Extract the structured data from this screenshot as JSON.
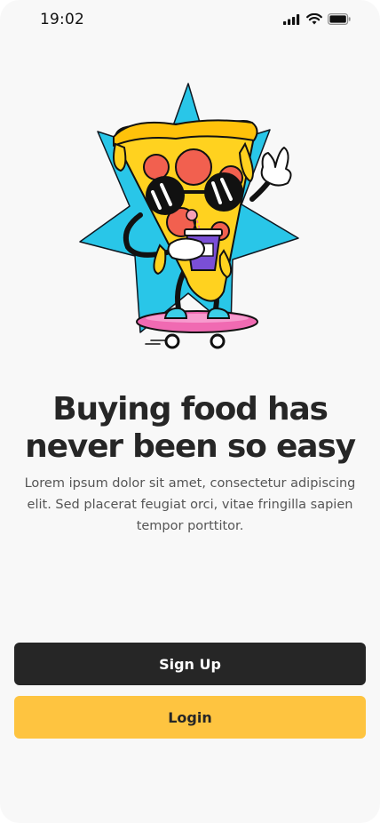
{
  "status_bar": {
    "time": "19:02"
  },
  "onboarding": {
    "headline_line1": "Buying food has",
    "headline_line2": "never been so easy",
    "description": "Lorem ipsum dolor sit amet, consectetur adipiscing elit. Sed placerat feugiat orci, vitae fringilla sapien tempor porttitor.",
    "illustration": "pizza-slice-skateboard-character"
  },
  "actions": {
    "signup_label": "Sign Up",
    "login_label": "Login"
  },
  "colors": {
    "background": "#f8f8f8",
    "text_dark": "#262626",
    "text_muted": "#555555",
    "primary_button": "#262626",
    "secondary_button": "#fec440",
    "star": "#29c6e8",
    "cheese": "#ffd21f",
    "pepperoni": "#f2604f",
    "board": "#f06ab2",
    "shoes": "#3ccfe8",
    "cup": "#7a4fd6"
  }
}
